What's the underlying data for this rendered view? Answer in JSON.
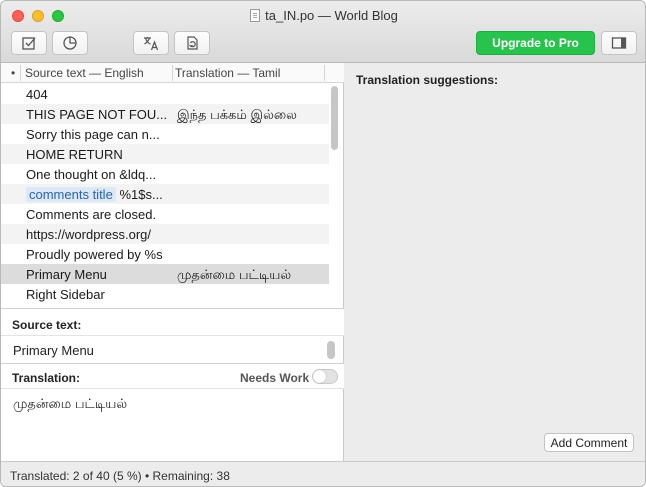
{
  "window": {
    "title": "ta_IN.po — World Blog"
  },
  "toolbar": {
    "buttons": [
      {
        "name": "validate",
        "icon": "checkbox-edit-icon"
      },
      {
        "name": "statistics",
        "icon": "pie-chart-icon"
      },
      {
        "name": "translate",
        "icon": "translate-icon"
      },
      {
        "name": "pretranslate",
        "icon": "document-sync-icon"
      },
      {
        "name": "sidebar",
        "icon": "sidebar-toggle-icon"
      }
    ],
    "upgrade_label": "Upgrade to Pro"
  },
  "list": {
    "header": {
      "dot": "•",
      "source_col": "Source text — English",
      "translation_col": "Translation — Tamil"
    },
    "rows": [
      {
        "source": "404",
        "translation": ""
      },
      {
        "source": "THIS PAGE NOT FOU...",
        "translation": "இந்த பக்கம் இல்லை"
      },
      {
        "source": "Sorry this page can n...",
        "translation": ""
      },
      {
        "source": "HOME RETURN",
        "translation": ""
      },
      {
        "source": "One thought on &ldq...",
        "translation": ""
      },
      {
        "source_tag": "comments title",
        "source": "%1$s...",
        "translation": ""
      },
      {
        "source": "Comments are closed.",
        "translation": ""
      },
      {
        "source": "https://wordpress.org/",
        "translation": ""
      },
      {
        "source": "Proudly powered by %s",
        "translation": ""
      },
      {
        "source": "Primary Menu",
        "translation": "முதன்மை பட்டியல்",
        "selected": true
      },
      {
        "source": "Right Sidebar",
        "translation": ""
      }
    ]
  },
  "editor": {
    "source_label": "Source text:",
    "source_value": "Primary Menu",
    "translation_label": "Translation:",
    "needs_work_label": "Needs Work",
    "translation_value": "முதன்மை பட்டியல்"
  },
  "sidebar": {
    "suggestions_label": "Translation suggestions:",
    "add_comment_label": "Add Comment"
  },
  "status": {
    "text": "Translated: 2 of 40 (5 %)  •  Remaining: 38"
  }
}
